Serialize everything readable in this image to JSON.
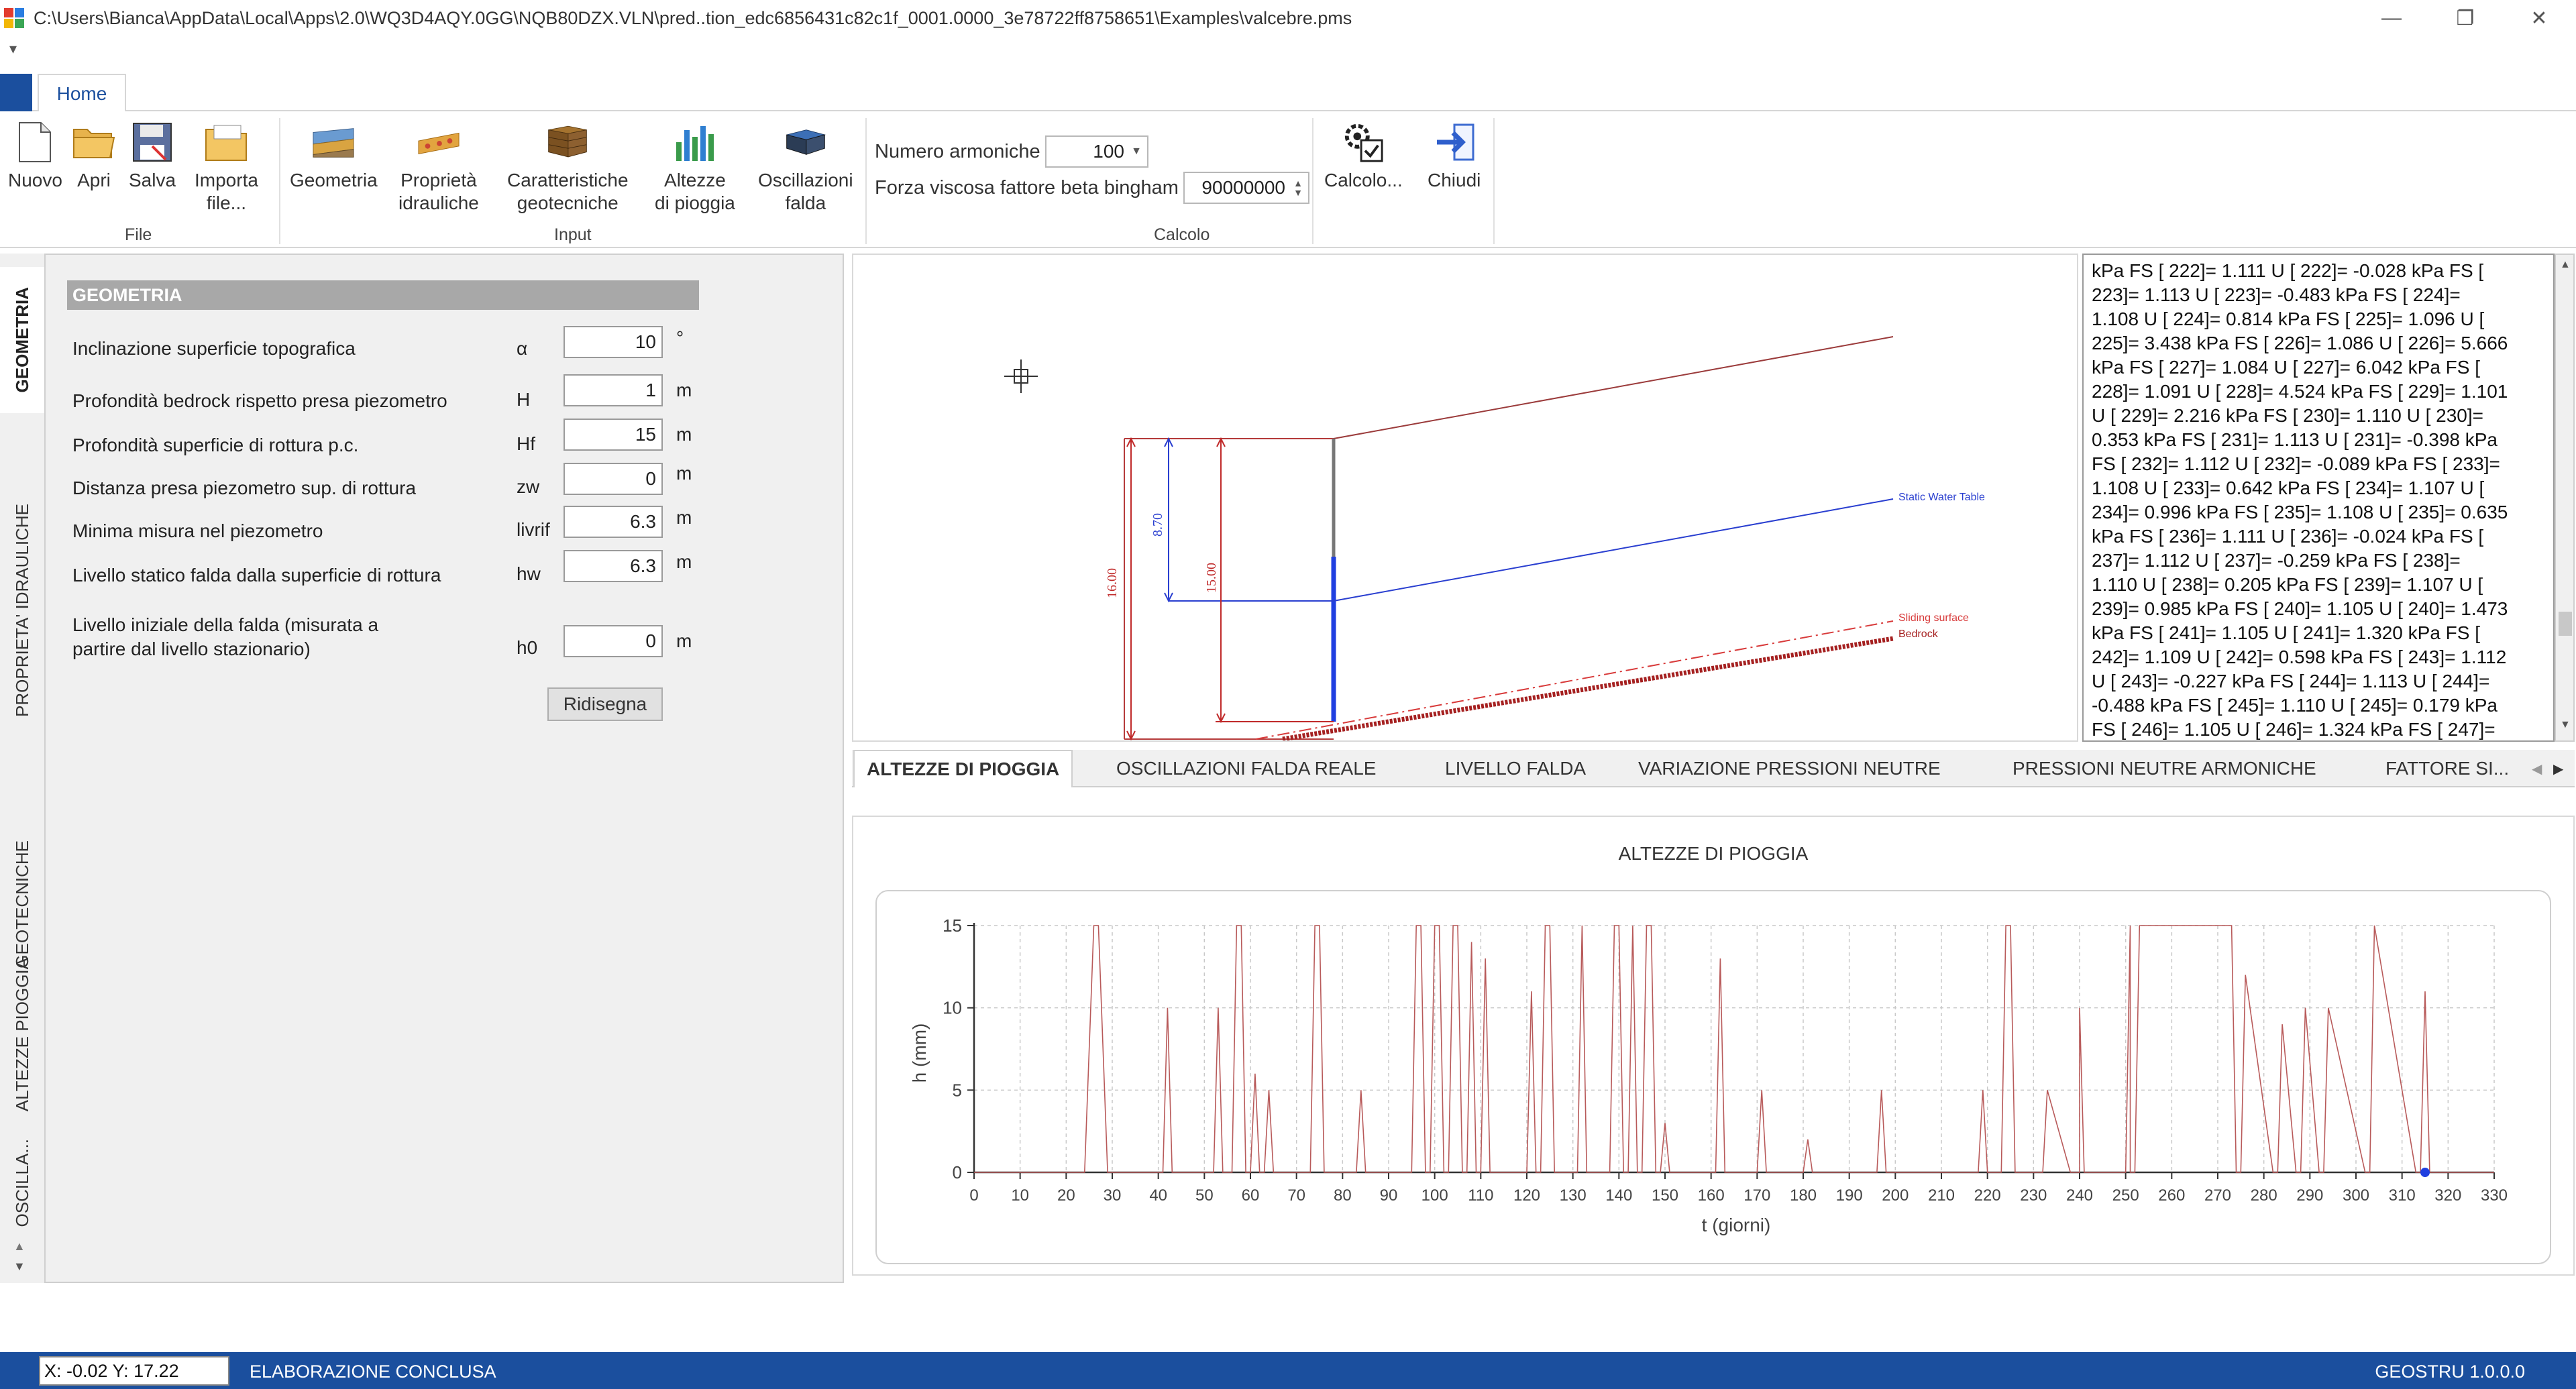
{
  "window": {
    "title": "C:\\Users\\Bianca\\AppData\\Local\\Apps\\2.0\\WQ3D4AQY.0GG\\NQB80DZX.VLN\\pred..tion_edc6856431c82c1f_0001.0000_3e78722ff8758651\\Examples\\valcebre.pms",
    "controls": {
      "minimize": "—",
      "restore": "❐",
      "close": "✕"
    }
  },
  "ribbon": {
    "tab_home": "Home",
    "file_group": {
      "label": "File",
      "nuovo": "Nuovo",
      "apri": "Apri",
      "salva": "Salva",
      "importa_line1": "Importa",
      "importa_line2": "file..."
    },
    "input_group": {
      "label": "Input",
      "geometria": "Geometria",
      "proprieta_line1": "Proprietà",
      "proprieta_line2": "idrauliche",
      "caratteristiche_line1": "Caratteristiche",
      "caratteristiche_line2": "geotecniche",
      "altezze_line1": "Altezze",
      "altezze_line2": "di pioggia",
      "oscillazioni_line1": "Oscillazioni",
      "oscillazioni_line2": "falda"
    },
    "calcolo_group": {
      "label": "Calcolo",
      "numero_armoniche_label": "Numero armoniche",
      "numero_armoniche_value": "100",
      "forza_viscosa_label": "Forza viscosa fattore beta bingham",
      "forza_viscosa_value": "90000000",
      "calcolo_btn": "Calcolo...",
      "chiudi_btn": "Chiudi"
    }
  },
  "vertical_tabs": [
    "GEOMETRIA",
    "PROPRIETA' IDRAULICHE",
    "GEOTECNICHE",
    "ALTEZZE PIOGGIA",
    "OSCILLA..."
  ],
  "geometria": {
    "header": "GEOMETRIA",
    "params": [
      {
        "label": "Inclinazione superficie topografica",
        "symbol": "α",
        "value": "10",
        "unit": "°"
      },
      {
        "label": "Profondità bedrock rispetto presa piezometro",
        "symbol": "H",
        "value": "1",
        "unit": "m"
      },
      {
        "label": "Profondità superficie di rottura p.c.",
        "symbol": "Hf",
        "value": "15",
        "unit": "m"
      },
      {
        "label": "Distanza presa piezometro sup. di rottura",
        "symbol": "zw",
        "value": "0",
        "unit": "m"
      },
      {
        "label": "Minima misura nel piezometro",
        "symbol": "livrif",
        "value": "6.3",
        "unit": "m"
      },
      {
        "label": "Livello statico falda dalla superficie di rottura",
        "symbol": "hw",
        "value": "6.3",
        "unit": "m"
      }
    ],
    "h0": {
      "label_line1": "Livello iniziale della falda (misurata a",
      "label_line2": "partire dal livello stazionario)",
      "symbol": "h0",
      "value": "0",
      "unit": "m"
    },
    "ridisegna": "Ridisegna"
  },
  "drawing": {
    "labels": {
      "static_water": "Static Water Table",
      "sliding": "Sliding surface",
      "bedrock": "Bedrock",
      "dim_16": "16.00",
      "dim_15": "15.00",
      "dim_870": "8.70"
    }
  },
  "log_lines": [
    "kPa FS [ 222]= 1.111 U [ 222]= -0.028 kPa FS [",
    "223]= 1.113 U [ 223]= -0.483 kPa FS [ 224]=",
    "1.108 U [ 224]= 0.814 kPa FS [ 225]= 1.096 U [",
    "225]= 3.438 kPa FS [ 226]= 1.086 U [ 226]= 5.666",
    "kPa FS [ 227]= 1.084 U [ 227]= 6.042 kPa FS [",
    "228]= 1.091 U [ 228]= 4.524 kPa FS [ 229]= 1.101",
    "U [ 229]= 2.216 kPa FS [ 230]= 1.110 U [ 230]=",
    "0.353 kPa FS [ 231]= 1.113 U [ 231]= -0.398 kPa",
    "FS [ 232]= 1.112 U [ 232]= -0.089 kPa FS [ 233]=",
    "1.108 U [ 233]= 0.642 kPa FS [ 234]= 1.107 U [",
    "234]= 0.996 kPa FS [ 235]= 1.108 U [ 235]= 0.635",
    "kPa FS [ 236]= 1.111 U [ 236]= -0.024 kPa FS [",
    "237]= 1.112 U [ 237]= -0.259 kPa FS [ 238]=",
    "1.110 U [ 238]= 0.205 kPa FS [ 239]= 1.107 U [",
    "239]= 0.985 kPa FS [ 240]= 1.105 U [ 240]= 1.473",
    "kPa FS [ 241]= 1.105 U [ 241]= 1.320 kPa FS [",
    "242]= 1.109 U [ 242]= 0.598 kPa FS [ 243]= 1.112",
    "U [ 243]= -0.227 kPa FS [ 244]= 1.113 U [ 244]=",
    "-0.488 kPa FS [ 245]= 1.110 U [ 245]= 0.179 kPa",
    "FS [ 246]= 1.105 U [ 246]= 1.324 kPa FS [ 247]="
  ],
  "chart_tabs": [
    "ALTEZZE DI PIOGGIA",
    "OSCILLAZIONI FALDA REALE",
    "LIVELLO FALDA",
    "VARIAZIONE PRESSIONI NEUTRE",
    "PRESSIONI NEUTRE ARMONICHE",
    "FATTORE SI..."
  ],
  "chart_data": {
    "type": "line",
    "title": "ALTEZZE DI PIOGGIA",
    "xlabel": "t (giorni)",
    "ylabel": "h (mm)",
    "xlim": [
      0,
      330
    ],
    "ylim": [
      0,
      15
    ],
    "xticks": [
      0,
      10,
      20,
      30,
      40,
      50,
      60,
      70,
      80,
      90,
      100,
      110,
      120,
      130,
      140,
      150,
      160,
      170,
      180,
      190,
      200,
      210,
      220,
      230,
      240,
      250,
      260,
      270,
      280,
      290,
      300,
      310,
      320,
      330
    ],
    "yticks": [
      0,
      5,
      10,
      15
    ],
    "grid": true,
    "series": [
      {
        "values_x": [
          0,
          24,
          26,
          27,
          29,
          30,
          41,
          42,
          43,
          52,
          53,
          54,
          56,
          57,
          58,
          59,
          60,
          61,
          62,
          63,
          64,
          65,
          66,
          73,
          74,
          75,
          76,
          83,
          84,
          85,
          95,
          96,
          97,
          98,
          99,
          100,
          101,
          102,
          103,
          104,
          105,
          106,
          107,
          108,
          109,
          110,
          111,
          112,
          119,
          120,
          121,
          122,
          123,
          124,
          125,
          126,
          131,
          132,
          133,
          138,
          139,
          140,
          141,
          142,
          143,
          144,
          145,
          146,
          147,
          148,
          149,
          150,
          151,
          152,
          153,
          154,
          155,
          156,
          161,
          162,
          163,
          170,
          171,
          172,
          180,
          181,
          182,
          196,
          197,
          198,
          218,
          219,
          220,
          223,
          224,
          225,
          226,
          227,
          231,
          232,
          233,
          238,
          239,
          240,
          240,
          241,
          242,
          249,
          250,
          251,
          251,
          252,
          253,
          273,
          274,
          275,
          276,
          282,
          283,
          284,
          287,
          288,
          289,
          292,
          293,
          294,
          302,
          303,
          304,
          313,
          314,
          315,
          316,
          317,
          318,
          319,
          330
        ],
        "values_y": [
          0,
          0,
          15,
          15,
          0,
          0,
          0,
          10,
          0,
          0,
          10,
          0,
          0,
          15,
          15,
          0,
          0,
          6,
          0,
          0,
          5,
          0,
          0,
          0,
          15,
          15,
          0,
          0,
          5,
          0,
          0,
          15,
          15,
          0,
          0,
          15,
          15,
          0,
          0,
          15,
          15,
          0,
          0,
          14,
          0,
          0,
          13,
          0,
          0,
          0,
          11,
          0,
          0,
          15,
          15,
          0,
          0,
          15,
          0,
          0,
          15,
          15,
          0,
          0,
          15,
          0,
          0,
          15,
          15,
          0,
          0,
          3,
          0,
          0,
          0,
          0,
          0,
          0,
          0,
          13,
          0,
          0,
          5,
          0,
          0,
          2,
          0,
          0,
          5,
          0,
          0,
          5,
          0,
          0,
          15,
          15,
          0,
          0,
          0,
          0,
          5,
          0,
          0,
          0,
          10,
          0,
          0,
          0,
          0,
          15,
          0,
          0,
          15,
          15,
          0,
          0,
          12,
          0,
          0,
          9,
          0,
          0,
          10,
          0,
          0,
          10,
          0,
          0,
          15,
          0,
          0,
          11,
          0,
          0,
          0,
          0,
          0
        ]
      }
    ],
    "marker": {
      "x": 315,
      "y": 0
    }
  },
  "status": {
    "coords": "X: -0.02 Y: 17.22",
    "message": "ELABORAZIONE CONCLUSA",
    "version": "GEOSTRU 1.0.0.0"
  }
}
